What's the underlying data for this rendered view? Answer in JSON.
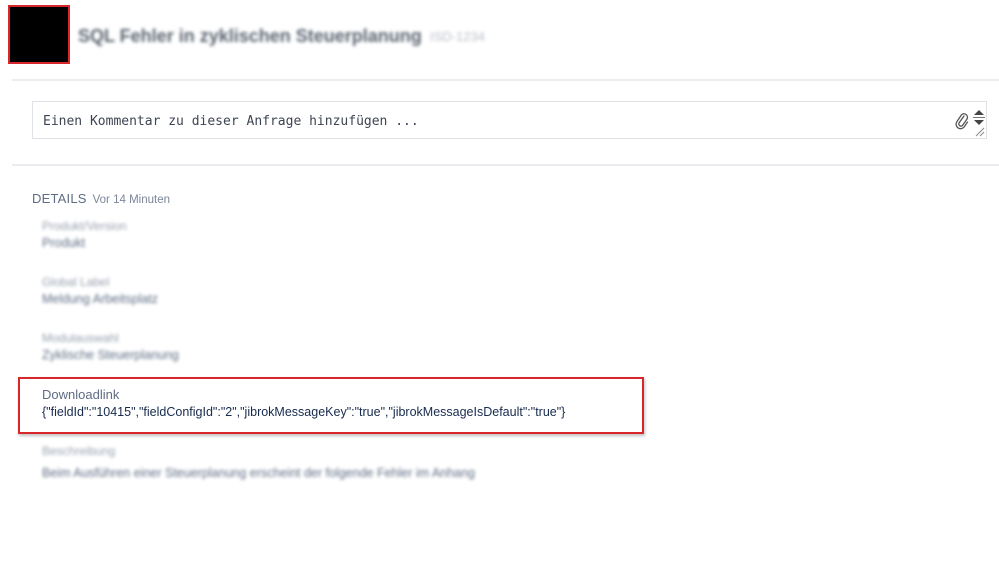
{
  "header": {
    "avatar": "redacted",
    "issue_title": "SQL Fehler in zyklischen Steuerplanung",
    "issue_key": "ISD-1234"
  },
  "comment": {
    "placeholder": "Einen Kommentar zu dieser Anfrage hinzufügen ..."
  },
  "details": {
    "label": "DETAILS",
    "time": "Vor 14 Minuten",
    "fields": [
      {
        "name": "Produkt/Version",
        "value": "Produkt"
      },
      {
        "name": "Global Label",
        "value": "Meldung Arbeitsplatz"
      },
      {
        "name": "Modulauswahl",
        "value": "Zyklische Steuerplanung"
      },
      {
        "name": "Downloadlink",
        "value": "{\"fieldId\":\"10415\",\"fieldConfigId\":\"2\",\"jibrokMessageKey\":\"true\",\"jibrokMessageIsDefault\":\"true\"}"
      },
      {
        "name": "Beschreibung",
        "value": "Beim Ausführen einer Steuerplanung erscheint der folgende Fehler im Anhang"
      }
    ]
  },
  "colors": {
    "highlight": "#d9262a",
    "rule": "#ebecf0"
  }
}
